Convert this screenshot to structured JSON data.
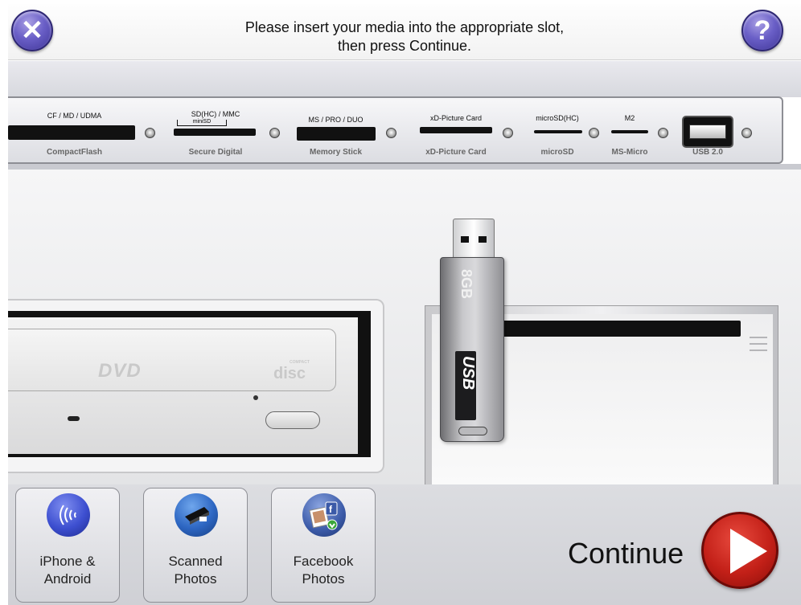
{
  "header": {
    "message_line1": "Please insert your media into the appropriate slot,",
    "message_line2": "then press Continue.",
    "close_icon": "close-x-icon",
    "help_icon": "question-mark-icon"
  },
  "slots": [
    {
      "top_label": "CF / MD / UDMA",
      "bottom_label": "CompactFlash"
    },
    {
      "top_label": "SD(HC) / MMC",
      "sub_label": "miniSD",
      "bottom_label": "Secure Digital"
    },
    {
      "top_label": "MS / PRO / DUO",
      "bottom_label": "Memory Stick"
    },
    {
      "top_label": "xD-Picture Card",
      "bottom_label": "xD-Picture Card"
    },
    {
      "top_label": "microSD(HC)",
      "bottom_label": "microSD"
    },
    {
      "top_label": "M2",
      "bottom_label": "MS-Micro"
    },
    {
      "top_label": "",
      "bottom_label": "USB 2.0"
    }
  ],
  "drive": {
    "dvd_logo": "DVD",
    "cd_logo": "disc",
    "cd_logo_small": "COMPACT"
  },
  "usb_stick": {
    "capacity": "8GB",
    "brand": "USB"
  },
  "footer": {
    "tiles": [
      {
        "label_line1": "iPhone &",
        "label_line2": "Android",
        "icon": "wireless-signal-icon"
      },
      {
        "label_line1": "Scanned",
        "label_line2": "Photos",
        "icon": "scanner-icon"
      },
      {
        "label_line1": "Facebook",
        "label_line2": "Photos",
        "icon": "facebook-photo-icon"
      }
    ],
    "continue_label": "Continue"
  },
  "colors": {
    "accent_purple": "#5b4fbf",
    "continue_red": "#c32018"
  }
}
